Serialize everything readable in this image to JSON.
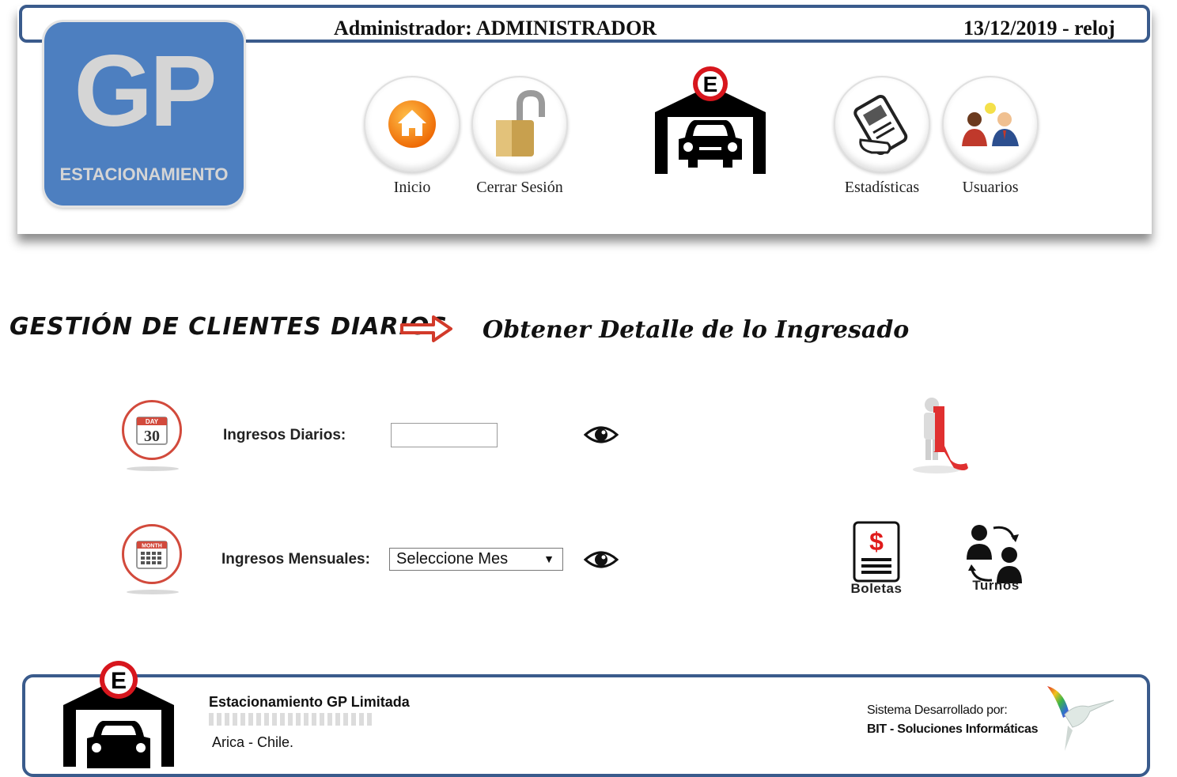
{
  "header": {
    "admin_label": "Administrador: ADMINISTRADOR",
    "datetime": "13/12/2019 - reloj",
    "logo": {
      "big": "GP",
      "sub": "ESTACIONAMIENTO"
    },
    "nav": [
      {
        "label": "Inicio",
        "icon": "home-icon"
      },
      {
        "label": "Cerrar Sesión",
        "icon": "padlock-icon"
      },
      {
        "label": "Estadísticas",
        "icon": "ticket-icon"
      },
      {
        "label": "Usuarios",
        "icon": "users-icon"
      }
    ],
    "garage_sign": "E"
  },
  "page": {
    "title": "GESTIÓN DE CLIENTES DIARIOS",
    "subtitle": "Obtener Detalle de lo Ingresado"
  },
  "rows": {
    "daily": {
      "label": "Ingresos Diarios:",
      "value": "",
      "calendar_top": "DAY",
      "calendar_num": "30"
    },
    "monthly": {
      "label": "Ingresos Mensuales:",
      "selected": "Seleccione Mes",
      "calendar_top": "MONTH"
    }
  },
  "actions": {
    "boletas": "Boletas",
    "turnos": "Turnos"
  },
  "footer": {
    "company": "Estacionamiento GP Limitada",
    "city": "Arica - Chile.",
    "dev_line1": "Sistema Desarrollado por:",
    "dev_line2": "BIT - Soluciones Informáticas",
    "garage_sign": "E"
  },
  "colors": {
    "frame_blue": "#3a5b8c",
    "logo_blue": "#4d7fc0",
    "accent_red": "#d24a3c",
    "arrow_red": "#d23a2a"
  }
}
